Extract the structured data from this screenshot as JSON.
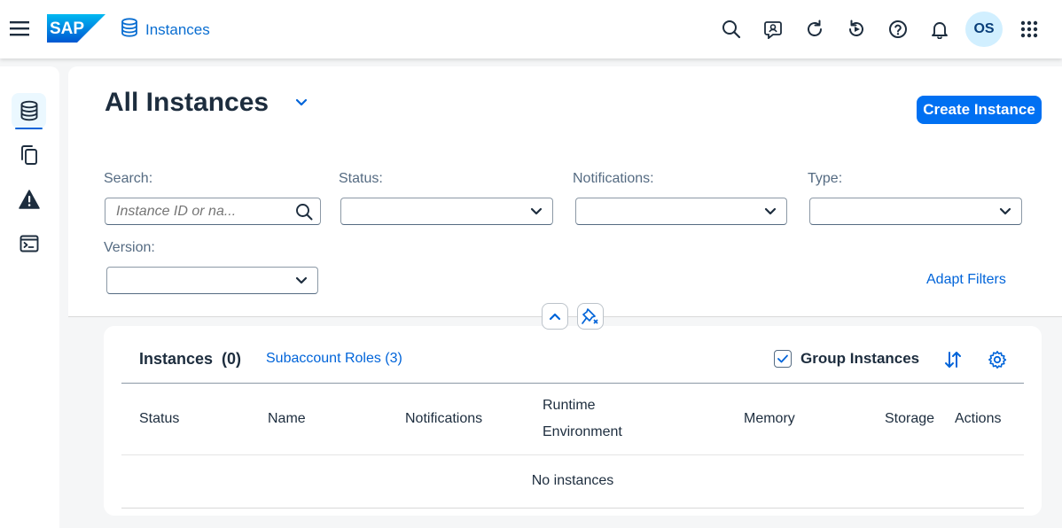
{
  "shell": {
    "logo_text": "SAP",
    "app_title": "Instances",
    "avatar_initials": "OS",
    "icons": [
      "search-icon",
      "feedback-icon",
      "refresh-icon",
      "history-icon",
      "help-icon",
      "bell-icon",
      "grid-icon"
    ]
  },
  "sidenav": {
    "items": [
      {
        "icon": "database-icon",
        "active": true
      },
      {
        "icon": "copy-icon",
        "active": false
      },
      {
        "icon": "warning-icon",
        "active": false
      },
      {
        "icon": "terminal-icon",
        "active": false
      }
    ]
  },
  "header": {
    "title": "All Instances",
    "create_button": "Create Instance"
  },
  "filters": {
    "search_label": "Search:",
    "search_placeholder": "Instance ID or na...",
    "status_label": "Status:",
    "notifications_label": "Notifications:",
    "type_label": "Type:",
    "version_label": "Version:",
    "adapt_filters": "Adapt Filters"
  },
  "table": {
    "title": "Instances  (0)",
    "subaccount_roles": "Subaccount Roles (3)",
    "group_instances": "Group Instances",
    "group_checked": true,
    "columns": [
      "Status",
      "Name",
      "Notifications",
      "Runtime",
      "Environment",
      "Memory",
      "Storage",
      "Actions"
    ],
    "empty_text": "No instances"
  },
  "colors": {
    "brand": "#0070f2",
    "link": "#0064d9",
    "text": "#1d2d3e"
  }
}
